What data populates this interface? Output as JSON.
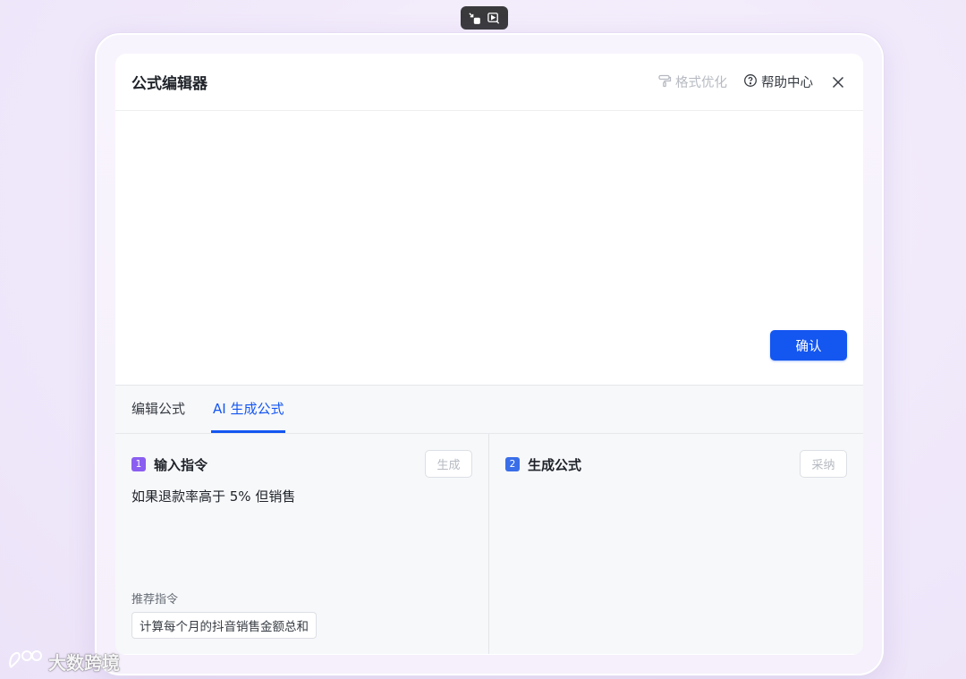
{
  "toolbar": {
    "icons": [
      "exit-fullscreen-icon",
      "play-screen-icon"
    ]
  },
  "dialog": {
    "title": "公式编辑器",
    "format_label": "格式优化",
    "help_label": "帮助中心",
    "confirm_label": "确认"
  },
  "tabs": [
    {
      "label": "编辑公式",
      "active": false
    },
    {
      "label": "AI 生成公式",
      "active": true
    }
  ],
  "input_panel": {
    "step": "1",
    "title": "输入指令",
    "action_label": "生成",
    "prompt": "如果退款率高于 5% 但销售",
    "recommend_label": "推荐指令",
    "recommend_chip": "计算每个月的抖音销售金额总和"
  },
  "output_panel": {
    "step": "2",
    "title": "生成公式",
    "action_label": "采纳"
  },
  "watermark": {
    "text": "大数跨境"
  },
  "colors": {
    "primary": "#1456f0",
    "step1": "#8a5ef0",
    "step2": "#3a6ee8",
    "background": "#f1eafb"
  }
}
